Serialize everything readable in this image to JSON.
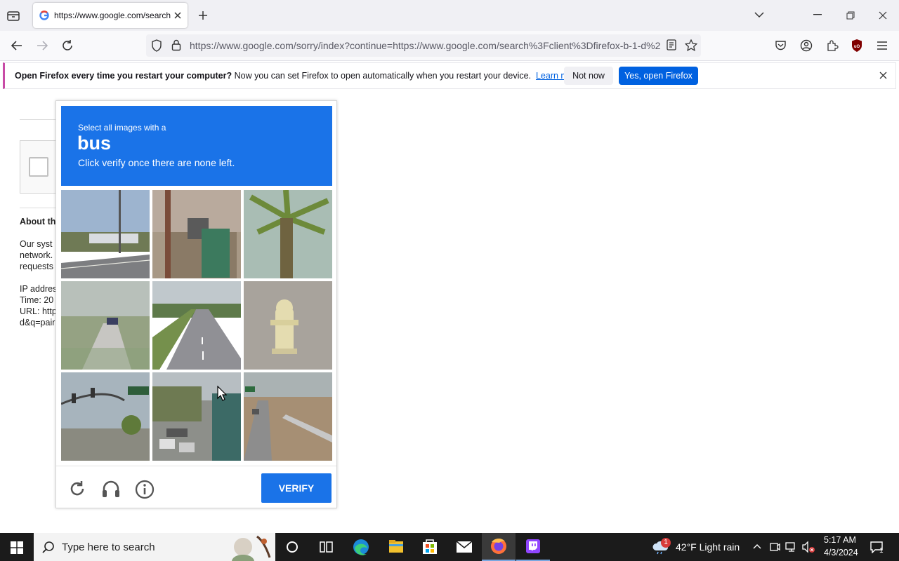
{
  "browser": {
    "tab_title": "https://www.google.com/search",
    "url": "https://www.google.com/sorry/index?continue=https://www.google.com/search%3Fclient%3Dfirefox-b-1-d%2"
  },
  "notification": {
    "bold": "Open Firefox every time you restart your computer?",
    "text": " Now you can set Firefox to open automatically when you restart your device.",
    "link": "Learn more",
    "not_now": "Not now",
    "yes": "Yes, open Firefox"
  },
  "page": {
    "about": "About th",
    "lines": [
      "Our syst",
      "network.",
      "requests"
    ],
    "lines2": [
      "IP addres",
      "Time: 20",
      "URL: http",
      "d&q=pair"
    ]
  },
  "captcha": {
    "line1": "Select all images with a",
    "target": "bus",
    "line3": "Click verify once there are none left.",
    "verify": "VERIFY"
  },
  "taskbar": {
    "search_placeholder": "Type here to search",
    "weather_badge": "1",
    "weather": "42°F  Light rain",
    "time": "5:17 AM",
    "date": "4/3/2024",
    "notif_count": "1"
  },
  "colors": {
    "accent": "#0061e0",
    "captcha_blue": "#1a73e8"
  }
}
